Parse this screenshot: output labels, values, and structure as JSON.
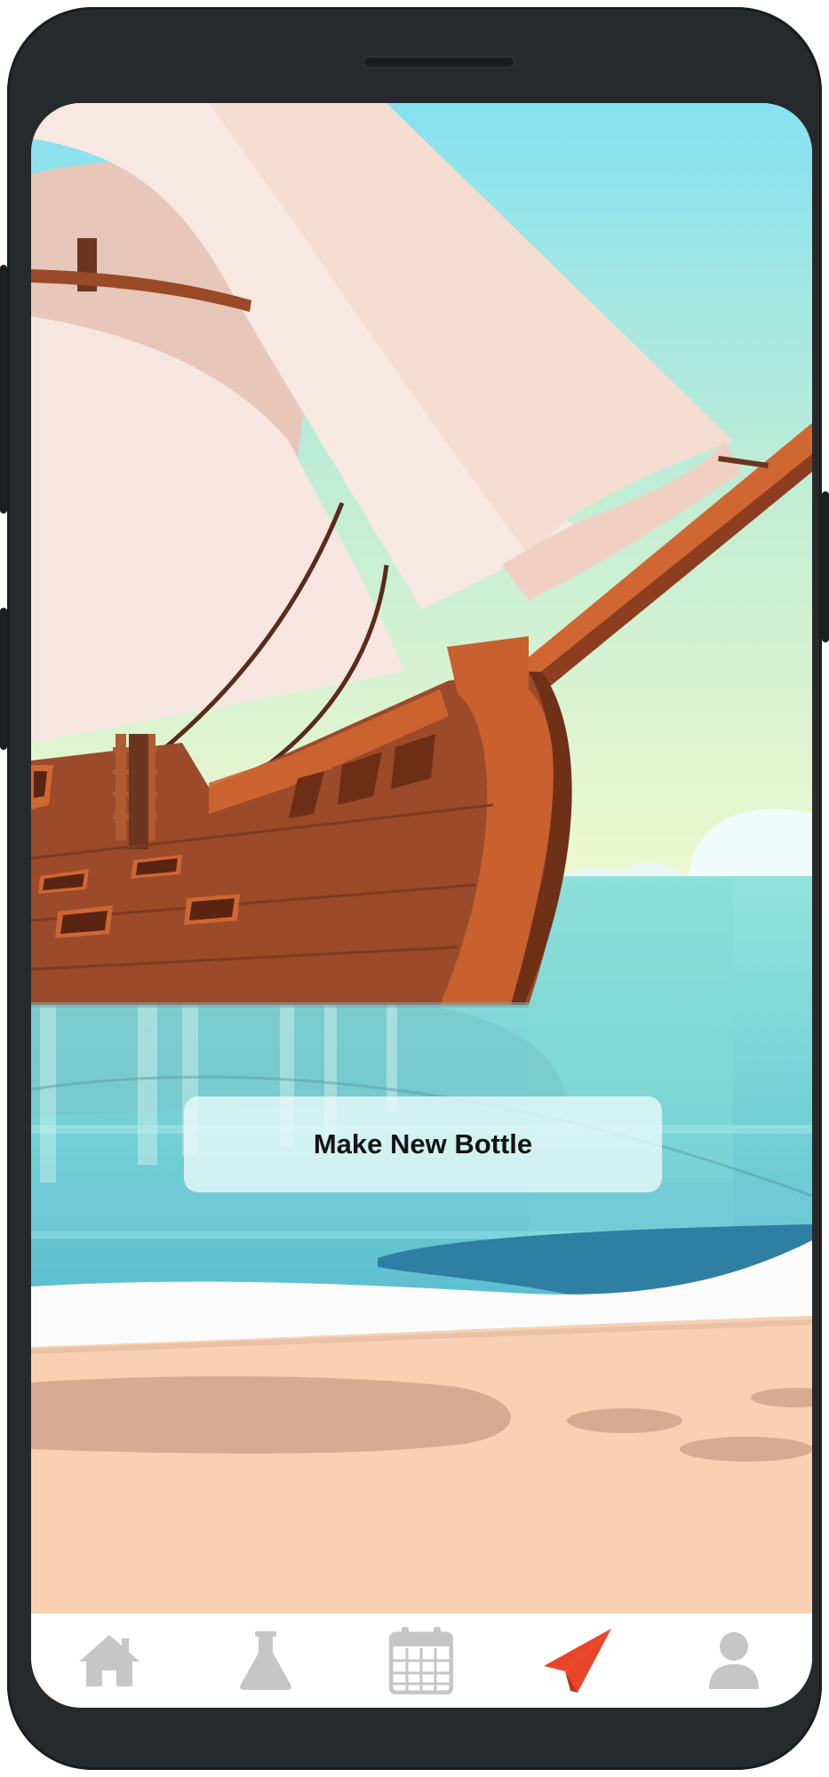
{
  "main": {
    "make_bottle_label": "Make New Bottle"
  },
  "tabbar": {
    "items": [
      {
        "icon": "home-icon",
        "active": false
      },
      {
        "icon": "flask-icon",
        "active": false
      },
      {
        "icon": "calendar-icon",
        "active": false
      },
      {
        "icon": "paper-plane-icon",
        "active": true
      },
      {
        "icon": "user-icon",
        "active": false
      }
    ],
    "active_color": "#e8462a",
    "inactive_color": "#c6c6c6"
  }
}
